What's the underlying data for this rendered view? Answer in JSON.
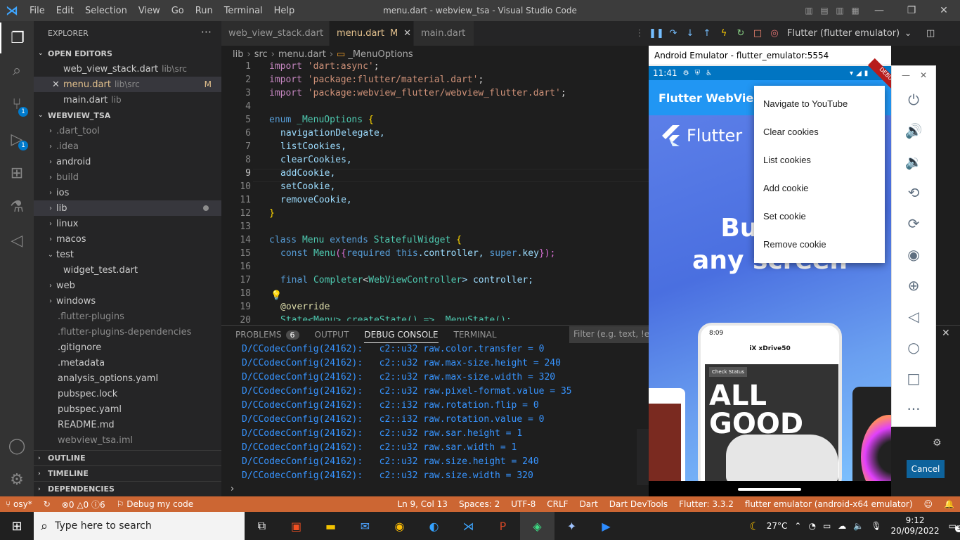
{
  "window": {
    "title": "menu.dart - webview_tsa - Visual Studio Code",
    "menu": [
      "File",
      "Edit",
      "Selection",
      "View",
      "Go",
      "Run",
      "Terminal",
      "Help"
    ]
  },
  "activity": {
    "source_control_badge": "1",
    "debug_badge": "1"
  },
  "sidebar": {
    "header": "EXPLORER",
    "open_editors_title": "OPEN EDITORS",
    "open_editors": [
      {
        "name": "web_view_stack.dart",
        "path": "lib\\src"
      },
      {
        "name": "menu.dart",
        "path": "lib\\src",
        "modified": "M"
      },
      {
        "name": "main.dart",
        "path": "lib"
      }
    ],
    "workspace_title": "WEBVIEW_TSA",
    "tree": [
      ".dart_tool",
      ".idea",
      "android",
      "build",
      "ios",
      "lib",
      "linux",
      "macos",
      "test",
      "widget_test.dart",
      "web",
      "windows",
      ".flutter-plugins",
      ".flutter-plugins-dependencies",
      ".gitignore",
      ".metadata",
      "analysis_options.yaml",
      "pubspec.lock",
      "pubspec.yaml",
      "README.md",
      "webview_tsa.iml"
    ],
    "outline": "OUTLINE",
    "timeline": "TIMELINE",
    "dependencies": "DEPENDENCIES"
  },
  "tabs": [
    {
      "label": "web_view_stack.dart"
    },
    {
      "label": "menu.dart",
      "badge": "M"
    },
    {
      "label": "main.dart"
    }
  ],
  "debug_config": "Flutter (flutter emulator)",
  "breadcrumb": [
    "lib",
    "src",
    "menu.dart",
    "_MenuOptions"
  ],
  "code": {
    "line_numbers": [
      "1",
      "2",
      "3",
      "4",
      "5",
      "6",
      "7",
      "8",
      "9",
      "10",
      "11",
      "12",
      "13",
      "14",
      "15",
      "16",
      "17",
      "18",
      "19",
      "20"
    ],
    "l1": [
      "import",
      "'dart:async'",
      ";"
    ],
    "l2": [
      "import",
      "'package:flutter/material.dart'",
      ";"
    ],
    "l3": [
      "import",
      "'package:webview_flutter/webview_flutter.dart'",
      ";"
    ],
    "l5": [
      "enum",
      "_MenuOptions",
      "{"
    ],
    "enum_values": [
      "navigationDelegate,",
      "listCookies,",
      "clearCookies,",
      "addCookie,",
      "setCookie,",
      "removeCookie,"
    ],
    "l12": "}",
    "l14": [
      "class",
      "Menu",
      "extends",
      "StatefulWidget",
      "{"
    ],
    "l15": [
      "const",
      "Menu",
      "({",
      "required",
      "this",
      ".controller, ",
      "super",
      ".key",
      "});"
    ],
    "l17": [
      "final",
      "Completer",
      "<",
      "WebViewController",
      "> controller;"
    ],
    "l19": "@override",
    "l20": "State<Menu> createState() => _MenuState();"
  },
  "panel": {
    "tabs": [
      "PROBLEMS",
      "OUTPUT",
      "DEBUG CONSOLE",
      "TERMINAL"
    ],
    "problems_count": "6",
    "filter_placeholder": "Filter (e.g. text, !exclude)",
    "logs": [
      "D/CCodecConfig(24162):   c2::u32 raw.color.transfer = 0",
      "D/CCodecConfig(24162):   c2::u32 raw.max-size.height = 240",
      "D/CCodecConfig(24162):   c2::u32 raw.max-size.width = 320",
      "D/CCodecConfig(24162):   c2::u32 raw.pixel-format.value = 35",
      "D/CCodecConfig(24162):   c2::i32 raw.rotation.flip = 0",
      "D/CCodecConfig(24162):   c2::i32 raw.rotation.value = 0",
      "D/CCodecConfig(24162):   c2::u32 raw.sar.height = 1",
      "D/CCodecConfig(24162):   c2::u32 raw.sar.width = 1",
      "D/CCodecConfig(24162):   c2::u32 raw.size.height = 240",
      "D/CCodecConfig(24162):   c2::u32 raw.size.width = 320"
    ],
    "prompt": "›",
    "cancel": "Cancel"
  },
  "emulator": {
    "title": "Android Emulator - flutter_emulator:5554",
    "time": "11:41",
    "debug_banner": "DEBUG",
    "appbar_title": "Flutter WebView",
    "logo_text": "Flutter",
    "headline1": "Build a",
    "headline2": "any screen",
    "mock_time": "8:09",
    "mock_title": "iX xDrive50",
    "mock_check": "Check Status",
    "mock_big1": "ALL",
    "mock_big2": "GOOD",
    "popup_menu": [
      "Navigate to YouTube",
      "Clear cookies",
      "List cookies",
      "Add cookie",
      "Set cookie",
      "Remove cookie"
    ]
  },
  "statusbar": {
    "branch": "osy*",
    "errors": "0",
    "warnings": "0",
    "infos": "6",
    "launch": "Debug my code",
    "position": "Ln 9, Col 13",
    "spaces": "Spaces: 2",
    "encoding": "UTF-8",
    "eol": "CRLF",
    "language": "Dart",
    "devtools": "Dart DevTools",
    "flutter": "Flutter: 3.3.2",
    "device": "flutter emulator (android-x64 emulator)"
  },
  "taskbar": {
    "search_placeholder": "Type here to search",
    "temperature": "27°C",
    "time": "9:12",
    "date": "20/09/2022",
    "notifications": "3"
  },
  "colors": {
    "accent": "#007acc",
    "statusbar": "#cc6633",
    "appbar": "#2196f3"
  }
}
